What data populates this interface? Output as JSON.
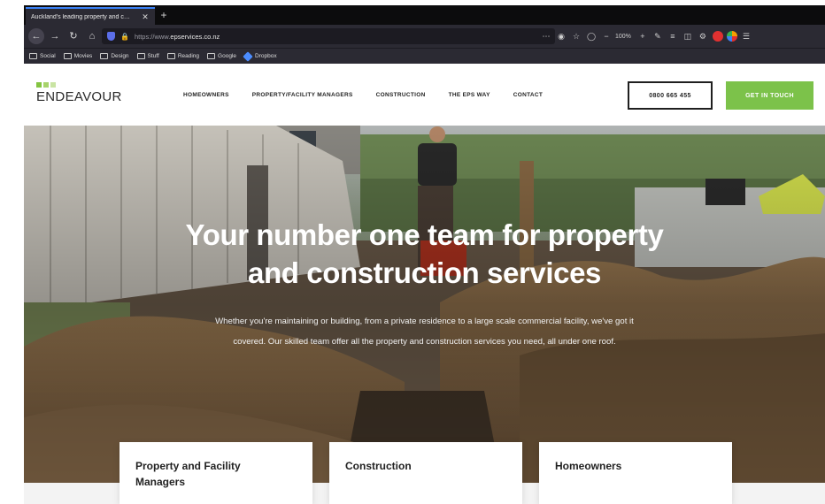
{
  "browser": {
    "tab_title": "Auckland's leading property and c…",
    "tab_close": "✕",
    "new_tab": "+",
    "url_prefix": "https://www.",
    "url_domain": "epservices.co.nz",
    "zoom": "100%",
    "bookmarks": [
      "Social",
      "Movies",
      "Design",
      "Stuff",
      "Reading",
      "Google"
    ],
    "bookmark_dropbox": "Dropbox"
  },
  "site": {
    "logo": "ENDEAVOUR",
    "nav": [
      "HOMEOWNERS",
      "PROPERTY/FACILITY MANAGERS",
      "CONSTRUCTION",
      "THE EPS WAY",
      "CONTACT"
    ],
    "phone": "0800 665 455",
    "cta": "GET IN TOUCH",
    "accent": "#7cc24a"
  },
  "hero": {
    "title_line1": "Your number one team for property",
    "title_line2": "and construction services",
    "subtitle_line1": "Whether you're maintaining or building, from a private residence to a large scale commercial facility, we've got it",
    "subtitle_line2": "covered. Our skilled team offer all the property and construction services you need, all under one roof."
  },
  "cards": [
    {
      "line1": "Property and Facility",
      "line2": "Managers"
    },
    {
      "line1": "Construction",
      "line2": ""
    },
    {
      "line1": "Homeowners",
      "line2": ""
    }
  ]
}
